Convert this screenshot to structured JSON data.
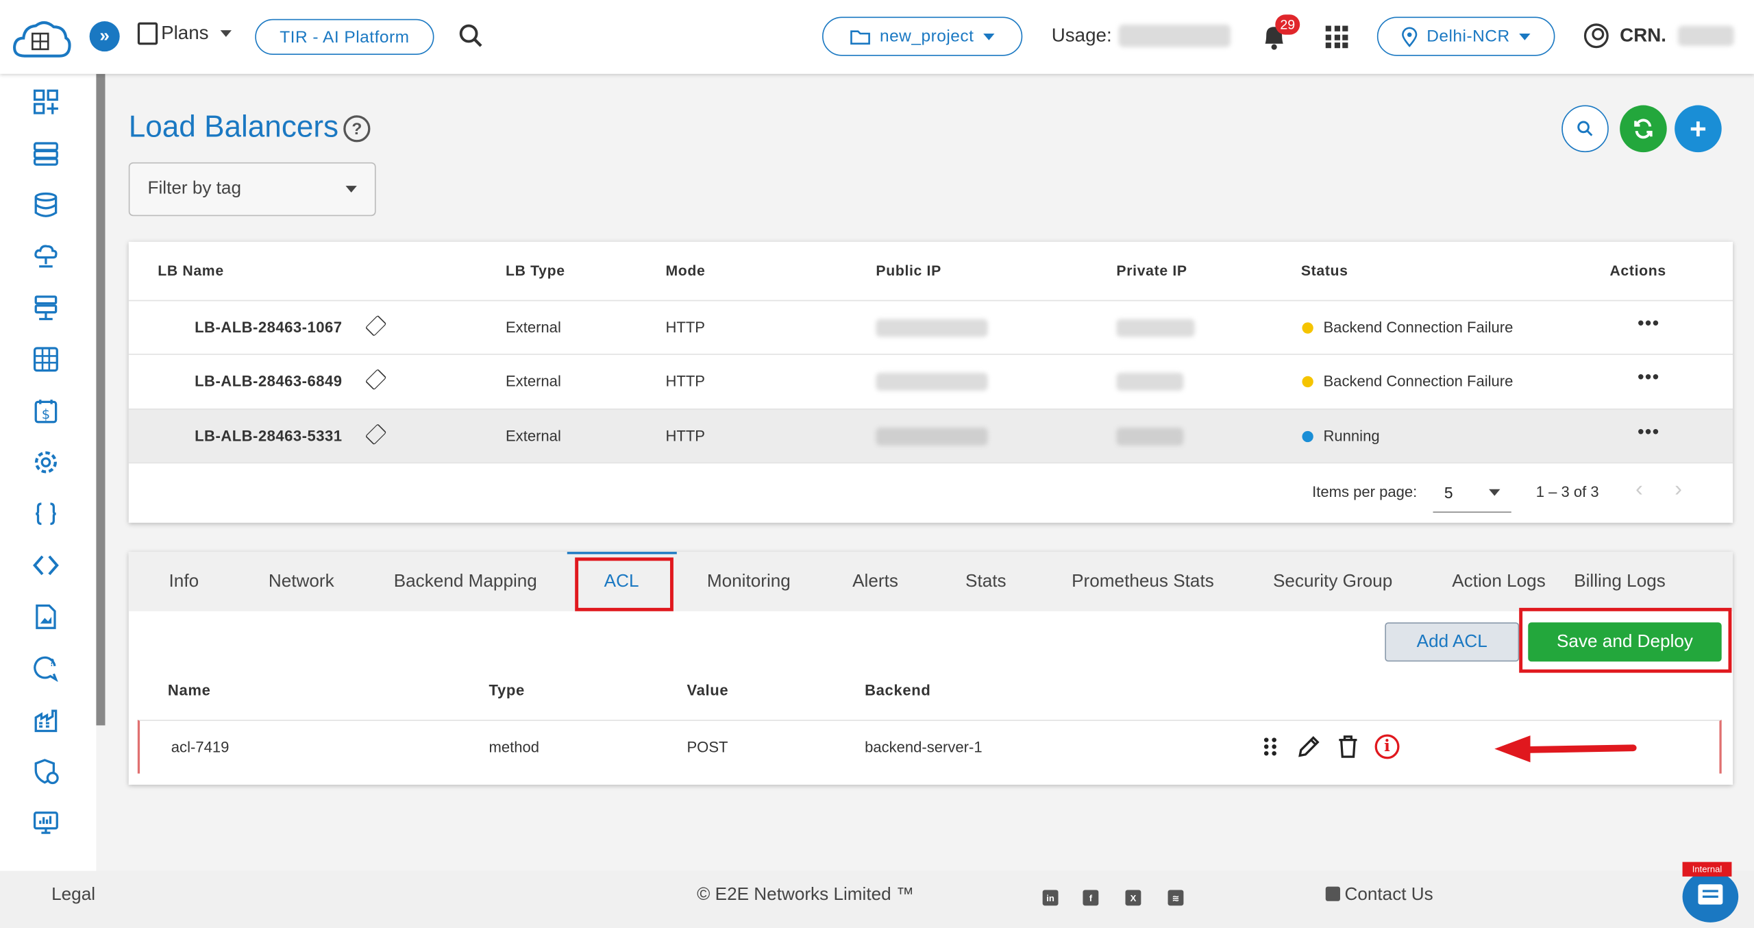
{
  "topbar": {
    "plans_label": "Plans",
    "platform_label": "TIR - AI Platform",
    "project_label": "new_project",
    "usage_label": "Usage:",
    "notification_count": "29",
    "region_label": "Delhi-NCR",
    "account_label": "CRN."
  },
  "sidebar": {
    "icons": [
      "dashboard-add-icon",
      "server-icon",
      "database-icon",
      "cloud-network-icon",
      "load-balancer-icon",
      "grid-icon",
      "billing-icon",
      "settings-icon",
      "code-braces-icon",
      "code-brackets-icon",
      "file-image-icon",
      "support-chat-icon",
      "organization-icon",
      "security-shield-icon",
      "monitor-icon"
    ]
  },
  "page": {
    "title": "Load Balancers",
    "help_icon": "?",
    "filter_placeholder": "Filter by tag"
  },
  "lb_table": {
    "columns": [
      "LB Name",
      "LB Type",
      "Mode",
      "Public IP",
      "Private IP",
      "Status",
      "Actions"
    ],
    "rows": [
      {
        "name": "LB-ALB-28463-1067",
        "type": "External",
        "mode": "HTTP",
        "status": "Backend Connection Failure",
        "status_color": "#f5c400"
      },
      {
        "name": "LB-ALB-28463-6849",
        "type": "External",
        "mode": "HTTP",
        "status": "Backend Connection Failure",
        "status_color": "#f5c400"
      },
      {
        "name": "LB-ALB-28463-5331",
        "type": "External",
        "mode": "HTTP",
        "status": "Running",
        "status_color": "#1a8ed6"
      }
    ],
    "more_label": "•••",
    "pagination": {
      "items_per_page_label": "Items per page:",
      "items_per_page_value": "5",
      "range_label": "1 – 3 of 3"
    }
  },
  "details": {
    "tabs": [
      "Info",
      "Network",
      "Backend Mapping",
      "ACL",
      "Monitoring",
      "Alerts",
      "Stats",
      "Prometheus Stats",
      "Security Group",
      "Action Logs",
      "Billing Logs"
    ],
    "active_tab": "ACL",
    "add_acl_label": "Add ACL",
    "save_deploy_label": "Save and Deploy",
    "acl_columns": [
      "Name",
      "Type",
      "Value",
      "Backend"
    ],
    "acl_row": {
      "name": "acl-7419",
      "type": "method",
      "value": "POST",
      "backend": "backend-server-1"
    }
  },
  "footer": {
    "legal_label": "Legal",
    "copyright": "© E2E Networks Limited ™",
    "contact_label": "Contact Us",
    "chat_badge": "Internal"
  },
  "colors": {
    "accent": "#1a78c2",
    "success": "#23a73c",
    "highlight": "#e0181e"
  }
}
